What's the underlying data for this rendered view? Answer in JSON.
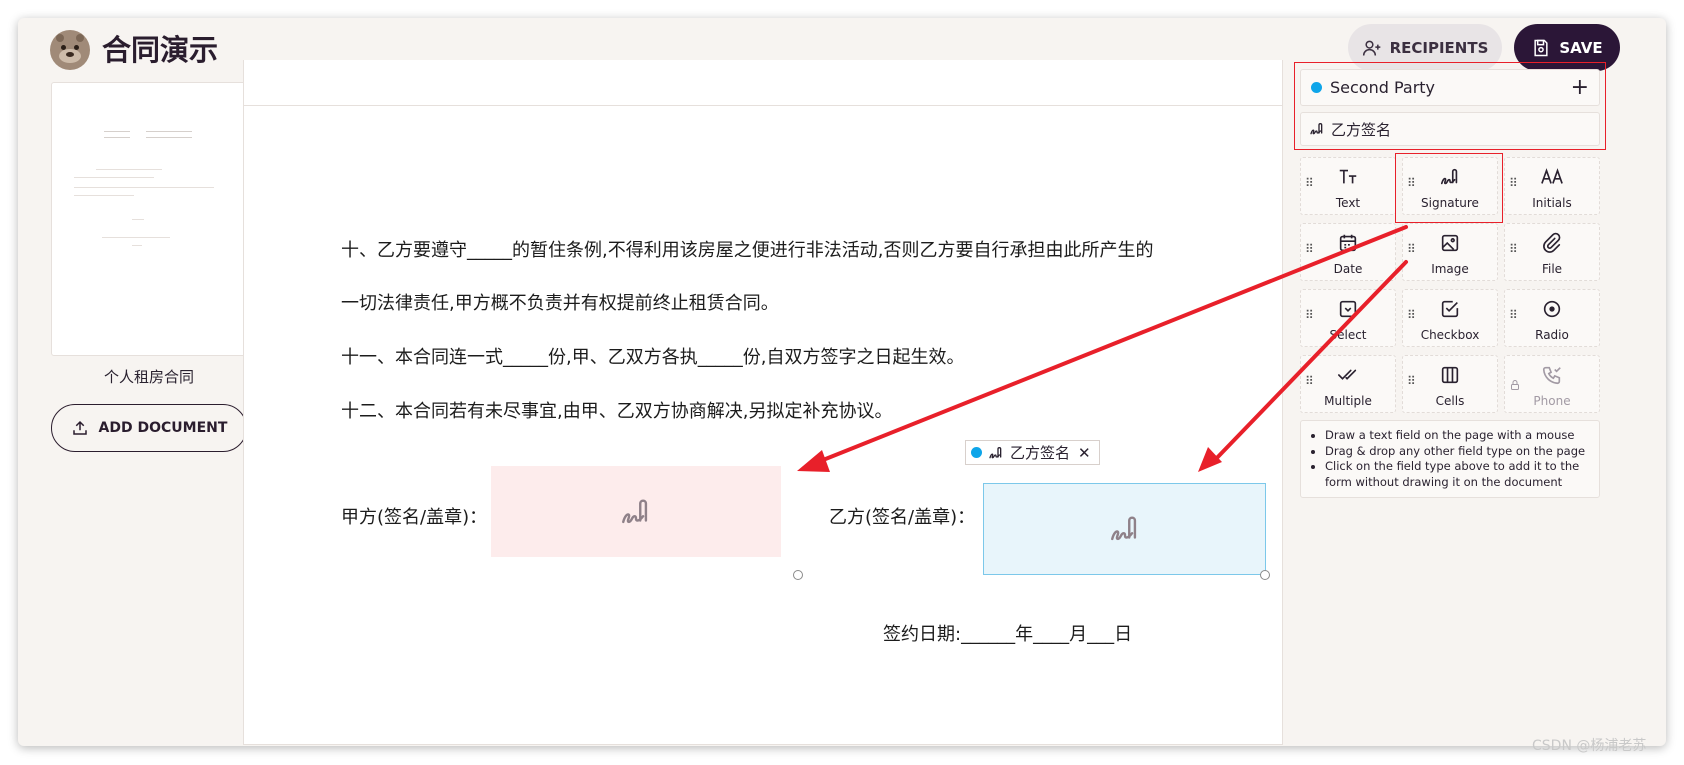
{
  "header": {
    "title": "合同演示",
    "recipients_label": "RECIPIENTS",
    "save_label": "SAVE"
  },
  "sidebar": {
    "document_name": "个人租房合同",
    "add_document_label": "ADD DOCUMENT"
  },
  "document": {
    "lines": [
      "十、乙方要遵守_____的暂住条例,不得利用该房屋之便进行非法活动,否则乙方要自行承担由此所产生的",
      "一切法律责任,甲方概不负责并有权提前终止租赁合同。",
      "十一、本合同连一式_____份,甲、乙双方各执_____份,自双方签字之日起生效。",
      "十二、本合同若有未尽事宜,由甲、乙双方协商解决,另拟定补充协议。"
    ],
    "party_a_label": "甲方(签名/盖章)：",
    "party_b_label": "乙方(签名/盖章)：",
    "placed_field_label": "乙方签名",
    "date_line": "签约日期:______年____月___日"
  },
  "panel": {
    "recipient": {
      "name": "Second Party",
      "color": "#0ea5e9"
    },
    "current_field_label": "乙方签名",
    "field_types": [
      {
        "label": "Text",
        "icon": "text-icon",
        "enabled": true
      },
      {
        "label": "Signature",
        "icon": "signature-icon",
        "enabled": true
      },
      {
        "label": "Initials",
        "icon": "initials-icon",
        "enabled": true
      },
      {
        "label": "Date",
        "icon": "calendar-icon",
        "enabled": true
      },
      {
        "label": "Image",
        "icon": "image-icon",
        "enabled": true
      },
      {
        "label": "File",
        "icon": "paperclip-icon",
        "enabled": true
      },
      {
        "label": "Select",
        "icon": "select-icon",
        "enabled": true
      },
      {
        "label": "Checkbox",
        "icon": "checkbox-icon",
        "enabled": true
      },
      {
        "label": "Radio",
        "icon": "radio-icon",
        "enabled": true
      },
      {
        "label": "Multiple",
        "icon": "multiple-check-icon",
        "enabled": true
      },
      {
        "label": "Cells",
        "icon": "cells-icon",
        "enabled": true
      },
      {
        "label": "Phone",
        "icon": "phone-icon",
        "enabled": false
      }
    ],
    "help": [
      "Draw a text field on the page with a mouse",
      "Drag & drop any other field type on the page",
      "Click on the field type above to add it to the form without drawing it on the document"
    ]
  },
  "annotation_color": "#e8202a",
  "watermark": "CSDN @杨浦老苏"
}
